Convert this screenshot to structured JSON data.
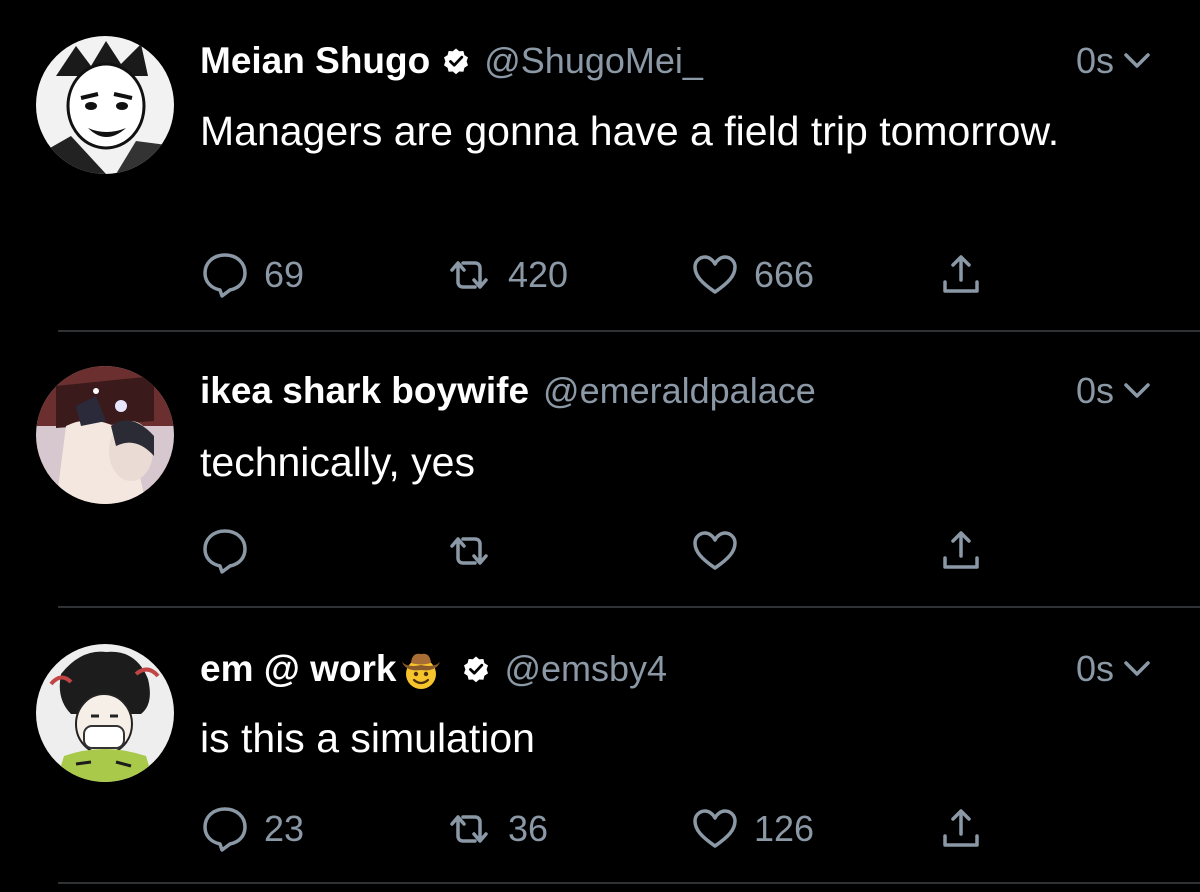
{
  "tweets": [
    {
      "name": "Meian Shugo",
      "verified": true,
      "handle": "@ShugoMei_",
      "time": "0s",
      "text": "Managers are gonna have a field trip tomorrow.",
      "replies": "69",
      "retweets": "420",
      "likes": "666"
    },
    {
      "name": "ikea shark boywife",
      "verified": false,
      "handle": "@emeraldpalace",
      "time": "0s",
      "text": "technically, yes",
      "replies": "",
      "retweets": "",
      "likes": ""
    },
    {
      "name": "em @ work",
      "name_emoji": "cowboy-face-emoji",
      "verified": true,
      "handle": "@emsby4",
      "time": "0s",
      "text": "is this a simulation",
      "replies": "23",
      "retweets": "36",
      "likes": "126"
    }
  ],
  "colors": {
    "background": "#000000",
    "text_primary": "#ffffff",
    "text_secondary": "#8b98a5",
    "divider": "#2f3336"
  },
  "icons": [
    "reply-icon",
    "retweet-icon",
    "like-icon",
    "share-icon",
    "verified-badge-icon",
    "chevron-down-icon"
  ]
}
